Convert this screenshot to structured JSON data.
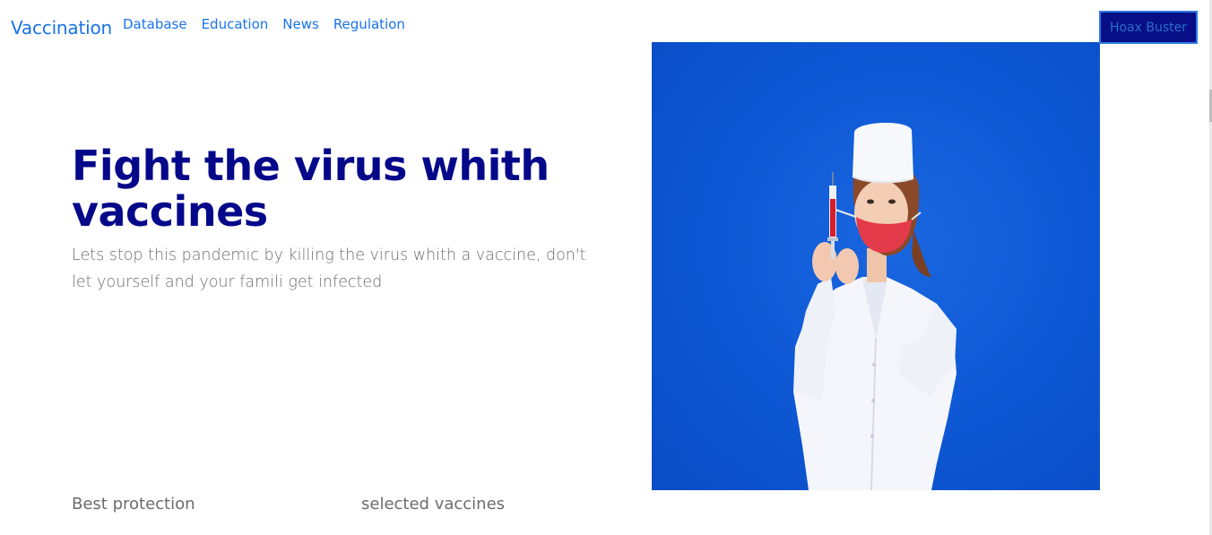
{
  "nav": {
    "brand": "Vaccination",
    "links": [
      "Database",
      "Education",
      "News",
      "Regulation"
    ],
    "cta_label": "Hoax Buster"
  },
  "hero": {
    "title": "Fight the virus whith vaccines",
    "subtitle": "Lets stop this pandemic by killing the virus whith a vaccine, don't let yourself and your famili get infected",
    "image_icon": "nurse-with-syringe-photo"
  },
  "features": [
    "Best protection",
    "selected vaccines"
  ],
  "colors": {
    "link": "#1a73e8",
    "title": "#06088a",
    "button_bg": "#080f86",
    "image_bg": "#0d57d4"
  }
}
